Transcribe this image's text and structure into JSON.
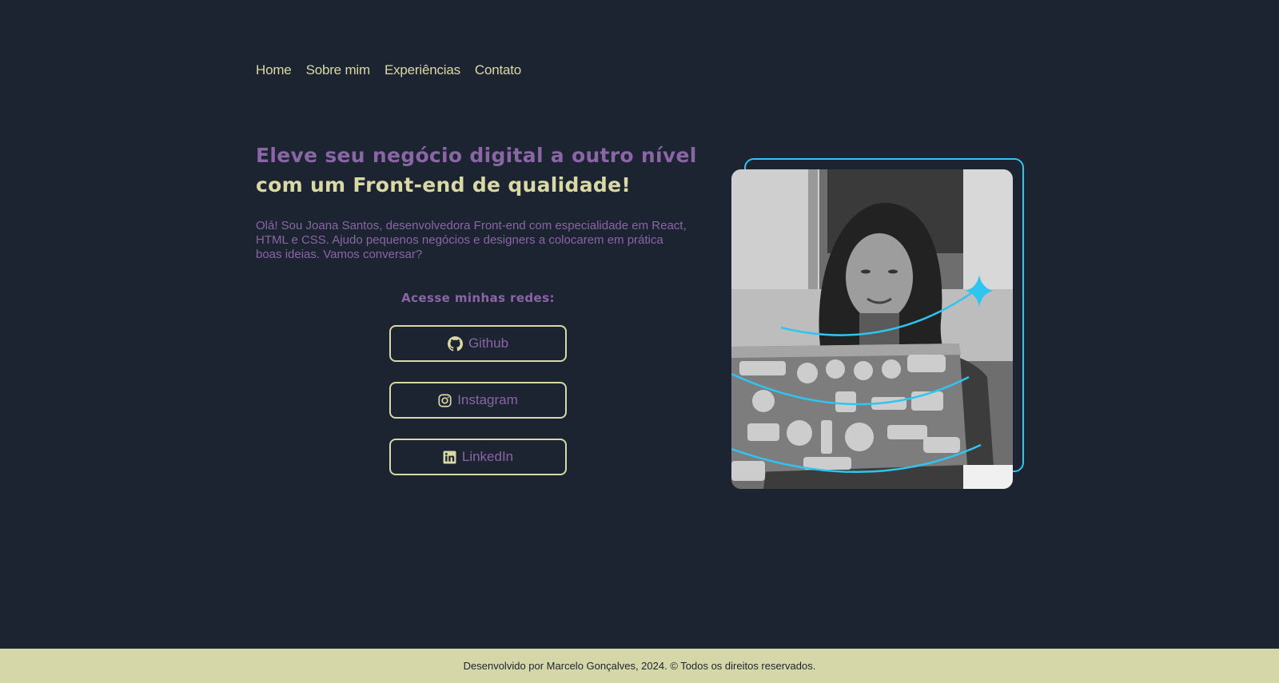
{
  "nav": {
    "items": [
      {
        "label": "Home"
      },
      {
        "label": "Sobre mim"
      },
      {
        "label": "Experiências"
      },
      {
        "label": "Contato"
      }
    ]
  },
  "hero": {
    "title_line1": "Eleve seu negócio digital a outro nível",
    "title_line2": "com um Front-end de qualidade!",
    "intro": "Olá! Sou Joana Santos, desenvolvedora Front-end com especialidade em React, HTML e CSS. Ajudo pequenos negócios e designers a colocarem em prática boas ideias. Vamos conversar?"
  },
  "social": {
    "heading": "Acesse minhas redes:",
    "buttons": [
      {
        "label": "Github",
        "icon": "github-icon"
      },
      {
        "label": "Instagram",
        "icon": "instagram-icon"
      },
      {
        "label": "LinkedIn",
        "icon": "linkedin-icon"
      }
    ]
  },
  "profile_image": {
    "alt": "Photo of Joana Santos working on a laptop",
    "frame_color": "#2ec5f0"
  },
  "footer": {
    "text": "Desenvolvido por Marcelo Gonçalves, 2024. © Todos os direitos reservados."
  },
  "colors": {
    "background": "#1c2331",
    "accent_purple": "#8a66a6",
    "accent_cream": "#d9d9a6",
    "accent_cyan": "#2ec5f0",
    "footer_background": "#d6d7a9"
  }
}
